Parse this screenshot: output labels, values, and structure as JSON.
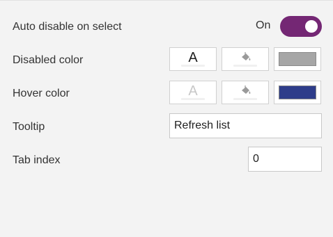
{
  "auto_disable": {
    "label": "Auto disable on select",
    "state_text": "On",
    "toggle_on": true,
    "toggle_color": "#742774"
  },
  "disabled_color": {
    "label": "Disabled color",
    "font_glyph": "A",
    "chip_color": "#a6a6a6"
  },
  "hover_color": {
    "label": "Hover color",
    "font_glyph": "A",
    "chip_color": "#2e3d8a"
  },
  "tooltip": {
    "label": "Tooltip",
    "value": "Refresh list"
  },
  "tab_index": {
    "label": "Tab index",
    "value": "0"
  },
  "icons": {
    "font_color": "font-color-icon",
    "fill_color": "paint-bucket-icon"
  }
}
